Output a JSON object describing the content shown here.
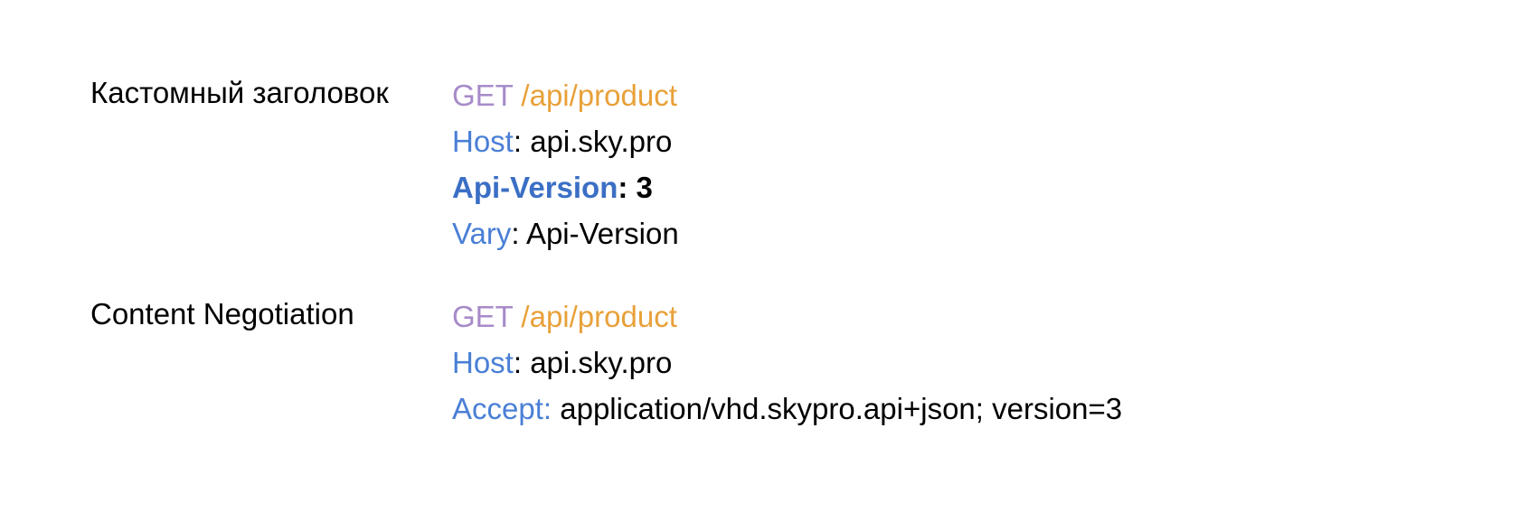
{
  "sections": [
    {
      "label": "Кастомный заголовок",
      "request": {
        "method": "GET",
        "path": "/api/product"
      },
      "headers": [
        {
          "key": "Host",
          "value": "api.sky.pro",
          "bold": false
        },
        {
          "key": "Api-Version",
          "value": "3",
          "bold": true
        },
        {
          "key": "Vary",
          "value": "Api-Version",
          "bold": false
        }
      ]
    },
    {
      "label": "Content Negotiation",
      "request": {
        "method": "GET",
        "path": "/api/product"
      },
      "headers": [
        {
          "key": "Host",
          "value": "api.sky.pro",
          "bold": false
        },
        {
          "key": "Accept",
          "value": "application/vhd.skypro.api+json; version=3",
          "bold": false
        }
      ]
    }
  ]
}
